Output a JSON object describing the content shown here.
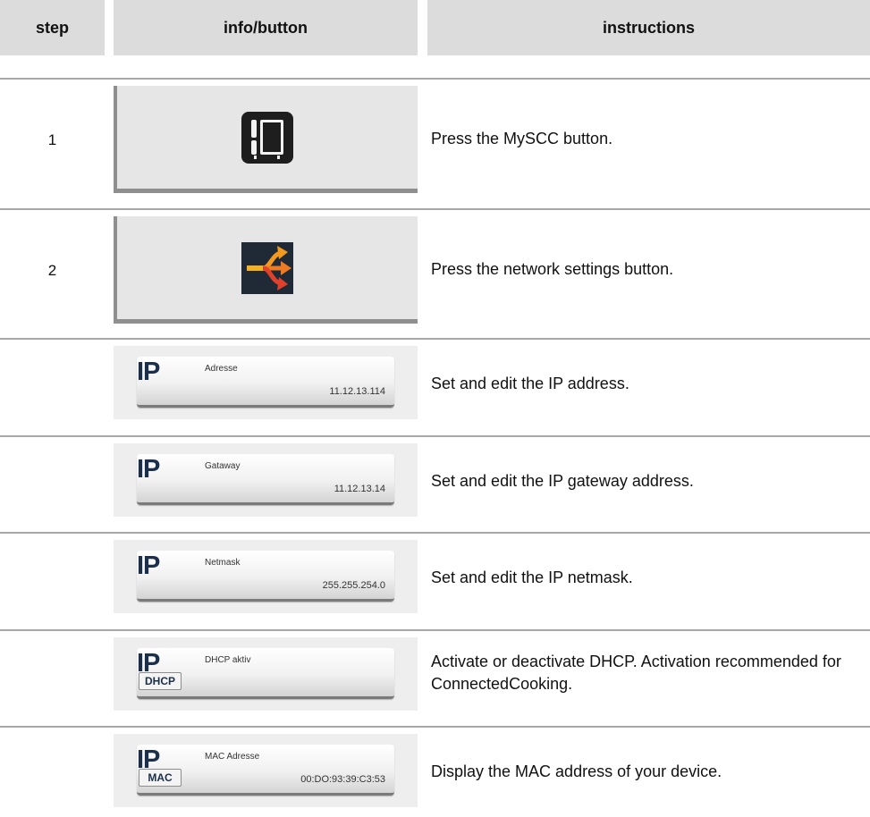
{
  "header": {
    "step": "step",
    "info": "info/button",
    "instructions": "instructions"
  },
  "rows": [
    {
      "step": "1",
      "icon": "myscc-icon",
      "instruction": "Press the MySCC button."
    },
    {
      "step": "2",
      "icon": "network-settings-icon",
      "instruction": "Press the network settings button."
    },
    {
      "ip": "IP",
      "label": "Adresse",
      "value": "11.12.13.114",
      "instruction": "Set and edit the IP address."
    },
    {
      "ip": "IP",
      "label": "Gataway",
      "value": "11.12.13.14",
      "instruction": "Set and edit the IP gateway address."
    },
    {
      "ip": "IP",
      "label": "Netmask",
      "value": "255.255.254.0",
      "instruction": "Set and edit the IP netmask."
    },
    {
      "ip": "IP",
      "tag": "DHCP",
      "label": "DHCP aktiv",
      "instruction": "Activate or deactivate DHCP. Activation recommended for ConnectedCooking."
    },
    {
      "ip": "IP",
      "tag": "MAC",
      "label": "MAC Adresse",
      "value": "00:DO:93:39:C3:53",
      "instruction": "Display the MAC address of your device."
    }
  ],
  "colors": {
    "header_bg": "#dcdcdc",
    "rule": "#a8a8a8",
    "ip_text": "#1b2f4a",
    "arrow_orange": "#f39a1e",
    "arrow_red": "#e0412a",
    "icon_bg": "#1f2a36"
  }
}
